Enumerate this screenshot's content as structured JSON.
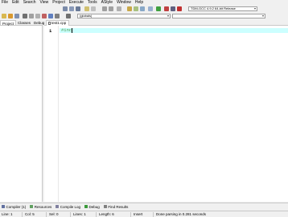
{
  "menu": [
    "File",
    "Edit",
    "Search",
    "View",
    "Project",
    "Execute",
    "Tools",
    "AStyle",
    "Window",
    "Help"
  ],
  "toolbar": {
    "compiler_select": "TDM-GCC 4.9.2 64-bit Release",
    "class_select": "(globals)",
    "function_select": ""
  },
  "left_panel": {
    "tabs": [
      "Project",
      "Classes",
      "Debug"
    ]
  },
  "editor": {
    "tab_label": "test1.cpp",
    "line_number": "1",
    "code": "#inc"
  },
  "bottom_tabs": [
    "Compiler (1)",
    "Resources",
    "Compile Log",
    "Debug",
    "Find Results"
  ],
  "status": {
    "line": "Line:   1",
    "col": "Col:   5",
    "sel": "Sel:   0",
    "lines": "Lines:   1",
    "length": "Length:   6",
    "mode": "Insert",
    "message": "Done parsing in 0.281 seconds"
  },
  "colors": {
    "current_line": "#ccffff",
    "preprocessor": "#4a9a4a"
  }
}
